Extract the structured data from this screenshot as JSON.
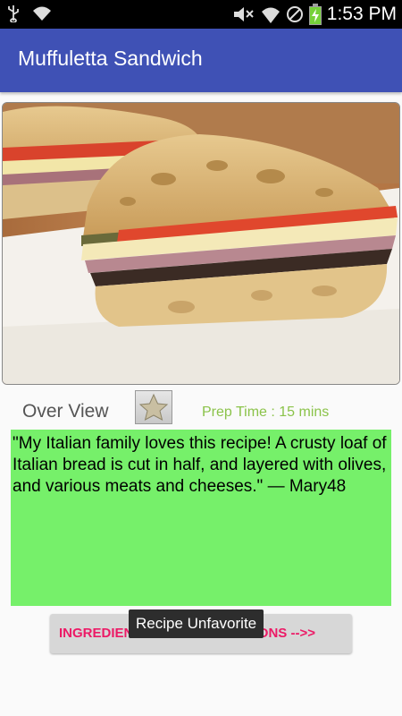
{
  "status_bar": {
    "time": "1:53 PM",
    "icons": [
      "usb-icon",
      "wifi-icon",
      "mute-icon",
      "signal-icon",
      "no-sim-icon",
      "battery-charging-icon"
    ]
  },
  "app_bar": {
    "title": "Muffuletta Sandwich",
    "color": "#3f51b5"
  },
  "recipe": {
    "image_subject": "muffuletta sandwich",
    "overview_label": "Over View",
    "prep_time": "Prep Time :  15 mins",
    "review": "\"My Italian family loves this recipe! A crusty loaf of Italian bread is cut in half, and layered with olives, and various meats and cheeses.\" — Mary48",
    "review_bg": "#76f06a"
  },
  "actions": {
    "favorite_icon": "star-icon",
    "ingredients_label": "INGREDIENTS AND INSTRUCTIONS -->>"
  },
  "toast": {
    "text": "Recipe Unfavorite"
  }
}
